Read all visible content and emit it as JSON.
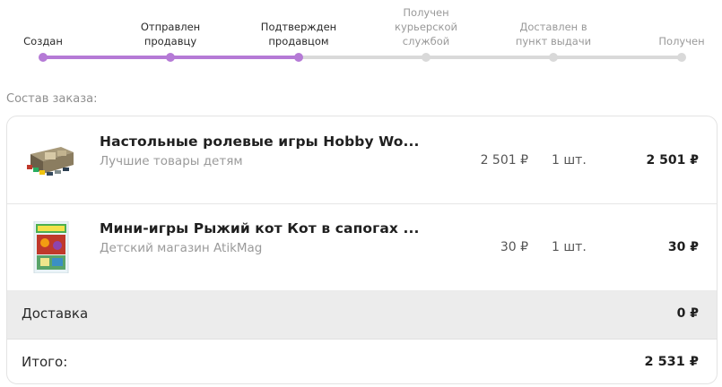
{
  "tracker": {
    "steps": [
      {
        "line1": "Создан",
        "line2": "",
        "line3": ""
      },
      {
        "line1": "Отправлен",
        "line2": "продавцу",
        "line3": ""
      },
      {
        "line1": "Подтвержден",
        "line2": "продавцом",
        "line3": ""
      },
      {
        "line1": "Получен",
        "line2": "курьерской",
        "line3": "службой"
      },
      {
        "line1": "Доставлен в",
        "line2": "пункт выдачи",
        "line3": ""
      },
      {
        "line1": "Получен",
        "line2": "",
        "line3": ""
      }
    ],
    "completed_steps": 3,
    "accent_color": "#b57ad6",
    "pending_color": "#d9d9d9"
  },
  "order": {
    "section_title": "Состав заказа:",
    "items": [
      {
        "name": "Настольные ролевые игры Hobby Wo...",
        "seller": "Лучшие товары детям",
        "price": "2 501 ₽",
        "qty": "1 шт.",
        "total": "2 501 ₽",
        "thumb_icon": "board-game-box-image"
      },
      {
        "name": "Мини-игры Рыжий кот Кот в сапогах ...",
        "seller": "Детский магазин AtikMag",
        "price": "30 ₽",
        "qty": "1 шт.",
        "total": "30 ₽",
        "thumb_icon": "mini-game-cover-image"
      }
    ],
    "delivery": {
      "label": "Доставка",
      "value": "0 ₽"
    },
    "grand_total": {
      "label": "Итого:",
      "value": "2 531 ₽"
    }
  }
}
